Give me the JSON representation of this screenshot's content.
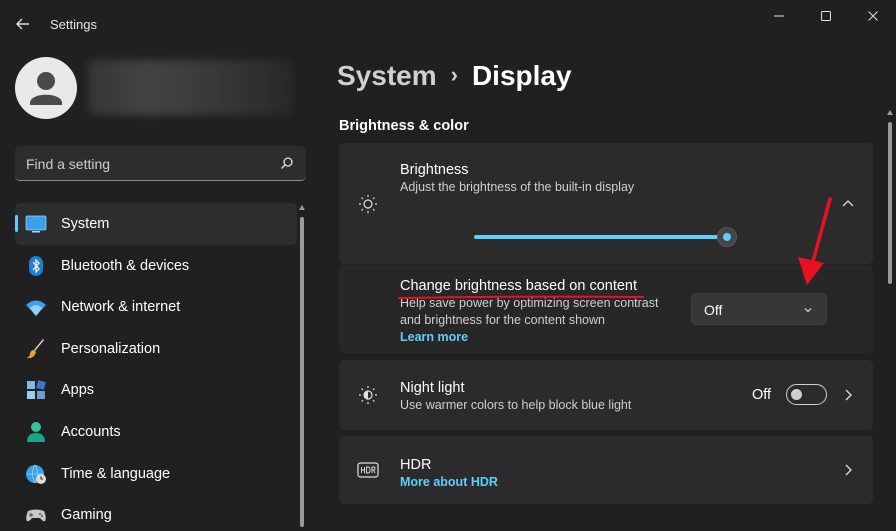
{
  "window": {
    "title": "Settings",
    "back_icon": "back-arrow-icon",
    "controls": [
      "minimize-icon",
      "maximize-icon",
      "close-icon"
    ]
  },
  "search": {
    "placeholder": "Find a setting",
    "icon": "search-icon"
  },
  "sidebar": {
    "items": [
      {
        "label": "System",
        "icon": "system-icon",
        "active": true
      },
      {
        "label": "Bluetooth & devices",
        "icon": "bluetooth-icon"
      },
      {
        "label": "Network & internet",
        "icon": "wifi-icon"
      },
      {
        "label": "Personalization",
        "icon": "paintbrush-icon"
      },
      {
        "label": "Apps",
        "icon": "apps-icon"
      },
      {
        "label": "Accounts",
        "icon": "accounts-icon"
      },
      {
        "label": "Time & language",
        "icon": "globe-clock-icon"
      },
      {
        "label": "Gaming",
        "icon": "gamepad-icon"
      }
    ]
  },
  "header": {
    "parent": "System",
    "separator": "›",
    "current": "Display"
  },
  "section": {
    "title": "Brightness & color"
  },
  "brightness": {
    "title": "Brightness",
    "description": "Adjust the brightness of the built-in display",
    "level": 0.96,
    "icon": "sun-icon"
  },
  "content_brightness": {
    "title": "Change brightness based on content",
    "description_line1": "Help save power by optimizing screen contrast",
    "description_line2": "and brightness for the content shown",
    "link": "Learn more",
    "value": "Off"
  },
  "night_light": {
    "title": "Night light",
    "description": "Use warmer colors to help block blue light",
    "state": "Off",
    "icon": "night-light-icon"
  },
  "hdr": {
    "title": "HDR",
    "link": "More about HDR",
    "icon": "hdr-icon"
  },
  "colors": {
    "accent": "#60cdff",
    "annotation": "#e81123"
  }
}
